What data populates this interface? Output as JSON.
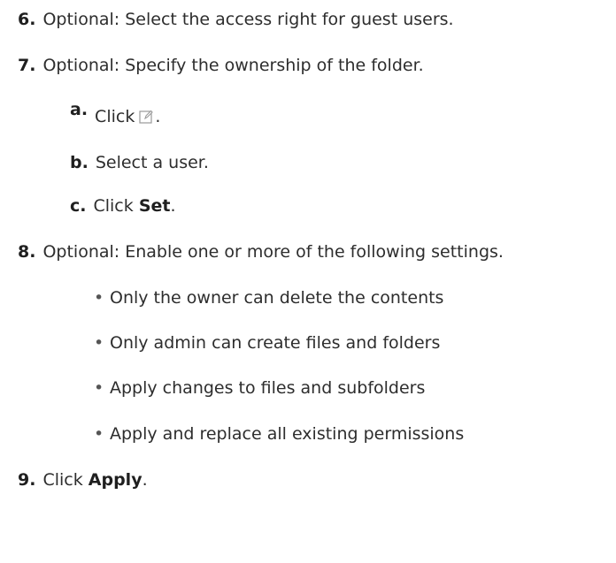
{
  "steps": [
    {
      "number": "6.",
      "text": "Optional: Select the access right for guest users."
    },
    {
      "number": "7.",
      "text": "Optional: Specify the ownership of the folder."
    },
    {
      "number": "8.",
      "text": "Optional: Enable one or more of the following settings."
    },
    {
      "number": "9.",
      "prefix": "Click ",
      "bold": "Apply",
      "suffix": "."
    }
  ],
  "substeps": [
    {
      "letter": "a.",
      "prefix": "Click",
      "suffix": ".",
      "icon": "edit-icon"
    },
    {
      "letter": "b.",
      "text": "Select a user."
    },
    {
      "letter": "c.",
      "prefix": "Click ",
      "bold": "Set",
      "suffix": "."
    }
  ],
  "settings": [
    "Only the owner can delete the contents",
    "Only admin can create files and folders",
    "Apply changes to files and subfolders",
    "Apply and replace all existing permissions"
  ],
  "bullet_char": "•"
}
